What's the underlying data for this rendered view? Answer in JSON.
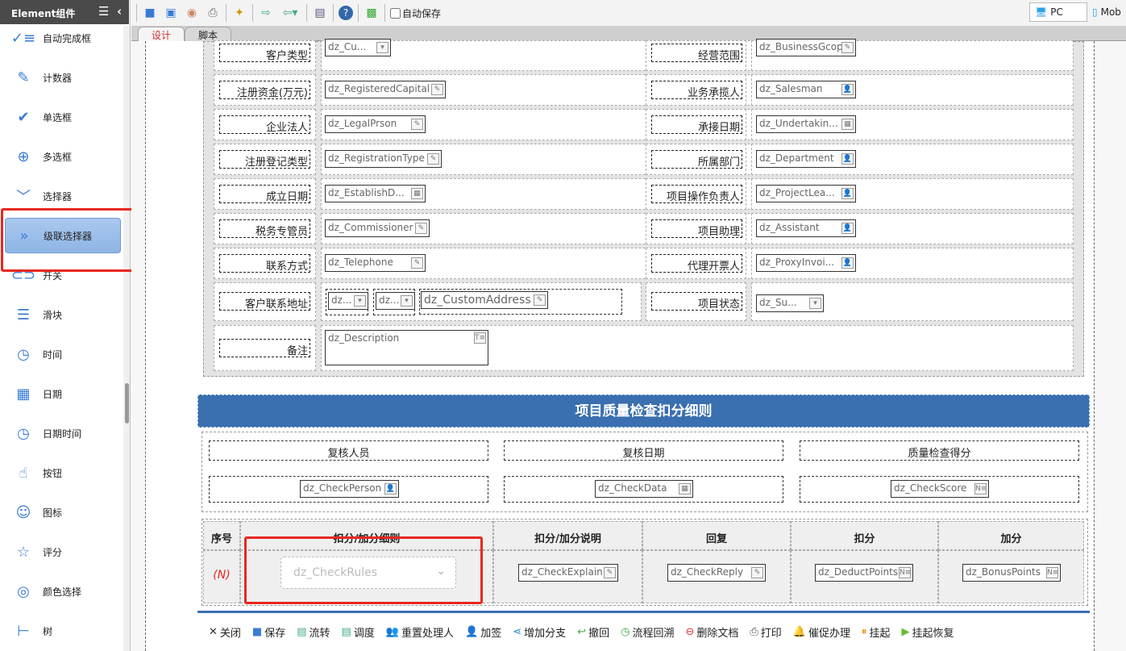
{
  "sidebar": {
    "title": "Element组件",
    "items": [
      {
        "label": "自动完成框",
        "icon": "autocomplete-icon",
        "glyph": "✓≡"
      },
      {
        "label": "计数器",
        "icon": "edit-icon",
        "glyph": "✎"
      },
      {
        "label": "单选框",
        "icon": "check-circle-icon",
        "glyph": "✔"
      },
      {
        "label": "多选框",
        "icon": "plus-circle-icon",
        "glyph": "⊕"
      },
      {
        "label": "选择器",
        "icon": "chevron-down-icon",
        "glyph": "﹀"
      },
      {
        "label": "级联选择器",
        "icon": "double-chevron-right-icon",
        "glyph": "»",
        "selected": true
      },
      {
        "label": "开关",
        "icon": "toggle-icon",
        "glyph": "⊂⊃"
      },
      {
        "label": "滑块",
        "icon": "sliders-icon",
        "glyph": "☰"
      },
      {
        "label": "时间",
        "icon": "clock-icon",
        "glyph": "◷"
      },
      {
        "label": "日期",
        "icon": "calendar-icon",
        "glyph": "▦"
      },
      {
        "label": "日期时间",
        "icon": "clock-icon",
        "glyph": "◷"
      },
      {
        "label": "按钮",
        "icon": "pointer-icon",
        "glyph": "☝"
      },
      {
        "label": "图标",
        "icon": "smile-icon",
        "glyph": "☺"
      },
      {
        "label": "评分",
        "icon": "star-icon",
        "glyph": "☆"
      },
      {
        "label": "颜色选择",
        "icon": "lifebuoy-icon",
        "glyph": "◎"
      },
      {
        "label": "树",
        "icon": "tree-icon",
        "glyph": "⊢"
      }
    ]
  },
  "toolbar": {
    "autosave": "自动保存",
    "pc": "PC",
    "mobile": "Mob"
  },
  "tabs": [
    "设计",
    "脚本"
  ],
  "form": {
    "rows": [
      {
        "l1": "客户类型",
        "f1": "dz_Cu...",
        "i1": "▾",
        "l2": "经营范围",
        "f2": "dz_BusinessGcope",
        "i2": "✎"
      },
      {
        "l1": "注册资金(万元)",
        "f1": "dz_RegisteredCapital",
        "i1": "✎",
        "l2": "业务承揽人",
        "f2": "dz_Salesman",
        "i2": "👤"
      },
      {
        "l1": "企业法人",
        "f1": "dz_LegalPrson",
        "i1": "✎",
        "l2": "承接日期",
        "f2": "dz_Undertakin...",
        "i2": "▦"
      },
      {
        "l1": "注册登记类型",
        "f1": "dz_RegistrationType",
        "i1": "✎",
        "l2": "所属部门",
        "f2": "dz_Department",
        "i2": "👤"
      },
      {
        "l1": "成立日期",
        "f1": "dz_EstablishD...",
        "i1": "▦",
        "l2": "项目操作负责人",
        "f2": "dz_ProjectLea...",
        "i2": "👤"
      },
      {
        "l1": "税务专管员",
        "f1": "dz_Commissioner",
        "i1": "✎",
        "l2": "项目助理",
        "f2": "dz_Assistant",
        "i2": "👤"
      },
      {
        "l1": "联系方式",
        "f1": "dz_Telephone",
        "i1": "✎",
        "l2": "代理开票人",
        "f2": "dz_ProxyInvoi...",
        "i2": "👤"
      }
    ],
    "address": {
      "label": "客户联系地址",
      "sel1": "dz...",
      "sel2": "dz...",
      "field": "dz_CustomAddress",
      "l2": "项目状态",
      "f2": "dz_Su..."
    },
    "remark": {
      "label": "备注",
      "field": "dz_Description"
    }
  },
  "section": {
    "title": "项目质量检查扣分细则",
    "review_headers": [
      "复核人员",
      "复核日期",
      "质量检查得分"
    ],
    "review_fields": [
      "dz_CheckPerson",
      "dz_CheckData",
      "dz_CheckScore"
    ],
    "table_headers": [
      "序号",
      "扣分/加分细则",
      "扣分/加分说明",
      "回复",
      "扣分",
      "加分"
    ],
    "row": {
      "index": "(N)",
      "rules": "dz_CheckRules",
      "explain": "dz_CheckExplain",
      "reply": "dz_CheckReply",
      "deduct": "dz_DeductPoints",
      "bonus": "dz_BonusPoints"
    }
  },
  "actions": [
    {
      "label": "关闭",
      "icon": "close-icon",
      "glyph": "✕",
      "color": "#333"
    },
    {
      "label": "保存",
      "icon": "save-icon",
      "glyph": "■",
      "color": "#3a7bd5"
    },
    {
      "label": "流转",
      "icon": "forward-icon",
      "glyph": "▤",
      "color": "#4a8"
    },
    {
      "label": "调度",
      "icon": "dispatch-icon",
      "glyph": "▤",
      "color": "#4a8"
    },
    {
      "label": "重置处理人",
      "icon": "users-icon",
      "glyph": "👥",
      "color": "#c80"
    },
    {
      "label": "加签",
      "icon": "user-add-icon",
      "glyph": "👤",
      "color": "#c80"
    },
    {
      "label": "增加分支",
      "icon": "branch-icon",
      "glyph": "⋖",
      "color": "#28c"
    },
    {
      "label": "撤回",
      "icon": "undo-icon",
      "glyph": "↩",
      "color": "#4a4"
    },
    {
      "label": "流程回溯",
      "icon": "history-icon",
      "glyph": "◷",
      "color": "#4a4"
    },
    {
      "label": "删除文档",
      "icon": "delete-icon",
      "glyph": "⊖",
      "color": "#d33"
    },
    {
      "label": "打印",
      "icon": "print-icon",
      "glyph": "⎙",
      "color": "#555"
    },
    {
      "label": "催促办理",
      "icon": "bell-icon",
      "glyph": "🔔",
      "color": "#d90"
    },
    {
      "label": "挂起",
      "icon": "pause-icon",
      "glyph": "⏸",
      "color": "#e80"
    },
    {
      "label": "挂起恢复",
      "icon": "resume-icon",
      "glyph": "▶",
      "color": "#6b3"
    }
  ]
}
